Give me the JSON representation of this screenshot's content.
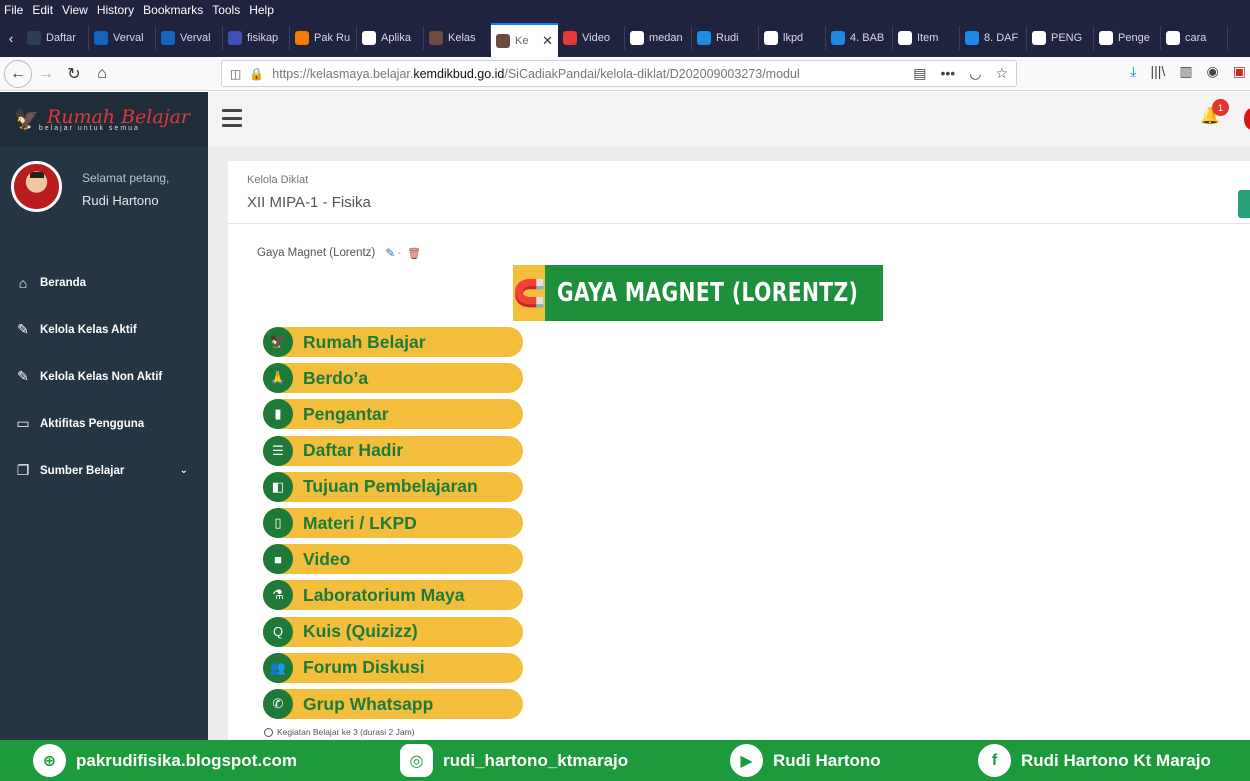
{
  "menubar": [
    "File",
    "Edit",
    "View",
    "History",
    "Bookmarks",
    "Tools",
    "Help"
  ],
  "tabs": [
    {
      "label": "Daftar",
      "color": "#2c3e50"
    },
    {
      "label": "Verval",
      "color": "#1565c0"
    },
    {
      "label": "Verval",
      "color": "#1565c0"
    },
    {
      "label": "fisikap",
      "color": "#3f51b5"
    },
    {
      "label": "Pak Ru",
      "color": "#f57c00"
    },
    {
      "label": "Aplika",
      "color": "#ffffff"
    },
    {
      "label": "Kelas",
      "color": "#6d4c41"
    },
    {
      "label": "Ke",
      "color": "#6d4c41",
      "active": true
    },
    {
      "label": "Video",
      "color": "#e53935"
    },
    {
      "label": "medan",
      "color": "#ffffff"
    },
    {
      "label": "Rudi",
      "color": "#1e88e5"
    },
    {
      "label": "lkpd",
      "color": "#ffffff"
    },
    {
      "label": "4. BAB",
      "color": "#1e88e5"
    },
    {
      "label": "Item",
      "color": "#ffffff"
    },
    {
      "label": "8. DAF",
      "color": "#1e88e5"
    },
    {
      "label": "PENG",
      "color": "#ffffff"
    },
    {
      "label": "Penge",
      "color": "#ffffff"
    },
    {
      "label": "cara",
      "color": "#ffffff"
    }
  ],
  "url": {
    "prefix": "https://kelasmaya.belajar.",
    "domain": "kemdikbud.go.id",
    "path": "/SiCadiakPandai/kelola-diklat/D202009003273/modul"
  },
  "sidebar": {
    "logo_title": "Rumah Belajar",
    "logo_tagline": "belajar untuk semua",
    "greeting": "Selamat petang,",
    "user_name": "Rudi Hartono",
    "items": [
      {
        "label": "Beranda",
        "icon": "home-icon"
      },
      {
        "label": "Kelola Kelas Aktif",
        "icon": "edit-icon"
      },
      {
        "label": "Kelola Kelas Non Aktif",
        "icon": "edit-icon"
      },
      {
        "label": "Aktifitas Pengguna",
        "icon": "monitor-icon"
      },
      {
        "label": "Sumber Belajar",
        "icon": "copy-icon"
      }
    ]
  },
  "topbar": {
    "notification_count": "1"
  },
  "page": {
    "breadcrumb": "Kelola Diklat",
    "title": "XII MIPA-1 - Fisika",
    "module_title": "Gaya Magnet (Lorentz)",
    "banner_text": "GAYA MAGNET (LORENTZ)",
    "activity": "Kegiatan Belajar ke 3 (durasi 2 Jam)"
  },
  "modules": [
    {
      "label": "Rumah Belajar",
      "icon": "rumah-belajar-icon"
    },
    {
      "label": "Berdo’a",
      "icon": "praying-hands-icon"
    },
    {
      "label": "Pengantar",
      "icon": "book-icon"
    },
    {
      "label": "Daftar Hadir",
      "icon": "checklist-icon"
    },
    {
      "label": "Tujuan Pembelajaran",
      "icon": "target-icon"
    },
    {
      "label": "Materi / LKPD",
      "icon": "tablet-icon"
    },
    {
      "label": "Video",
      "icon": "video-camera-icon"
    },
    {
      "label": "Laboratorium Maya",
      "icon": "microscope-icon"
    },
    {
      "label": "Kuis (Quizizz)",
      "icon": "quiz-icon"
    },
    {
      "label": "Forum Diskusi",
      "icon": "people-icon"
    },
    {
      "label": "Grup Whatsapp",
      "icon": "whatsapp-icon"
    }
  ],
  "footer": [
    {
      "label": "pakrudifisika.blogspot.com",
      "icon": "blogger-icon"
    },
    {
      "label": "rudi_hartono_ktmarajo",
      "icon": "instagram-icon"
    },
    {
      "label": "Rudi Hartono",
      "icon": "youtube-icon"
    },
    {
      "label": "Rudi Hartono Kt Marajo",
      "icon": "facebook-icon"
    }
  ],
  "colors": {
    "sidebar": "#263544",
    "accent_green": "#1f7a3a",
    "pill_yellow": "#f2be3c",
    "footer_green": "#1d9a3c"
  }
}
